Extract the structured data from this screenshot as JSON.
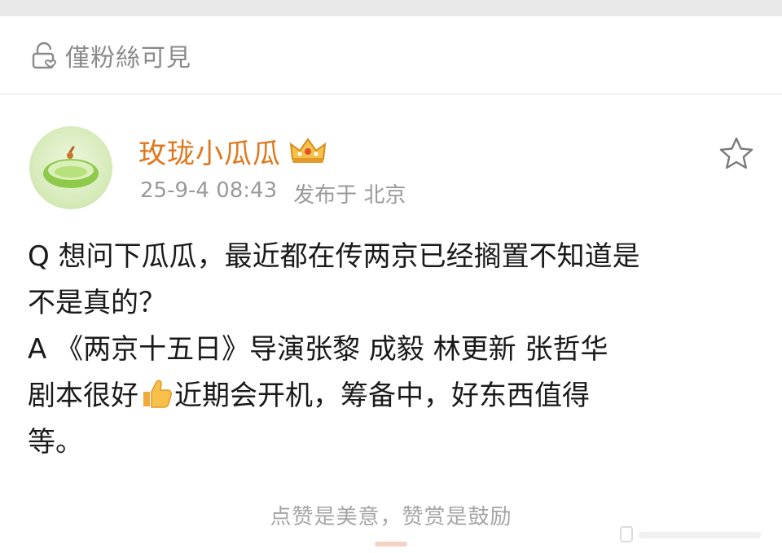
{
  "visibility": {
    "icon": "lock-heart-icon",
    "label": "僅粉絲可見"
  },
  "post": {
    "author": {
      "name": "玫珑小瓜瓜",
      "avatar_icon": "melon-avatar",
      "badge_icon": "crown-icon"
    },
    "meta": {
      "time": "25-9-4 08:43",
      "location": "发布于 北京"
    },
    "favorite_icon": "star-icon",
    "content": {
      "lines": [
        "Q 想问下瓜瓜，最近都在传两京已经搁置不知道是",
        "不是真的？",
        "A 《两京十五日》导演张黎 成毅 林更新 张哲华",
        "剧本很好",
        "近期会开机，筹备中，好东西值得",
        "等。"
      ],
      "emoji_icon": "thumbs-up-emoji"
    },
    "footer_text": "点赞是美意，赞赏是鼓励"
  },
  "colors": {
    "username": "#e0771c",
    "meta": "#9a9a9a",
    "muted": "#8a8a8a"
  }
}
